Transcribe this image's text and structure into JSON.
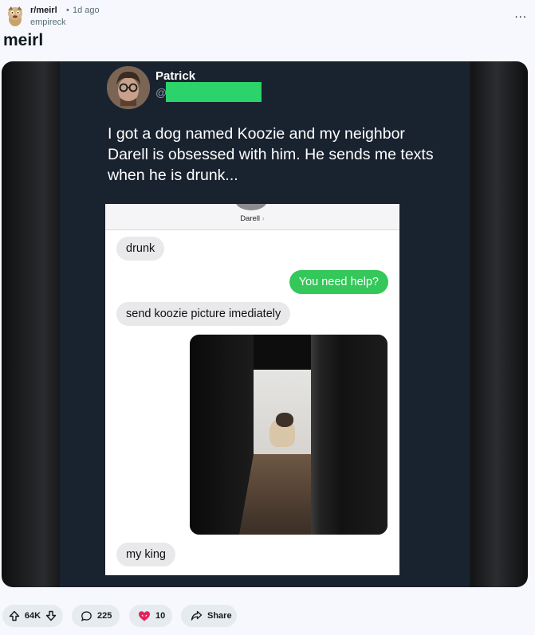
{
  "post": {
    "subreddit": "r/meirl",
    "separator": "•",
    "time_ago": "1d ago",
    "author": "empireck",
    "more_label": "...",
    "title": "meirl"
  },
  "tweet": {
    "name": "Patrick",
    "handle_prefix": "@",
    "text": "I got a dog named Koozie and my neighbor Darell is obsessed with him. He sends me texts when he is drunk..."
  },
  "screenshot": {
    "contact_name": "Darell",
    "contact_chevron": "›",
    "messages": [
      {
        "from": "them",
        "text": "drunk"
      },
      {
        "from": "me",
        "text": "You need help?"
      },
      {
        "from": "them",
        "text": "send koozie picture imediately"
      },
      {
        "from": "them",
        "text": "my king"
      }
    ]
  },
  "actions": {
    "votes": "64K",
    "comments": "225",
    "awards": "10",
    "share_label": "Share"
  },
  "icons": {
    "subreddit": "snoo-avatar-icon",
    "upvote": "arrow-up-icon",
    "downvote": "arrow-down-icon",
    "comment": "speech-bubble-icon",
    "award": "heart-award-icon",
    "share": "share-arrow-icon"
  },
  "colors": {
    "page_bg": "#f6f8fd",
    "tweet_bg": "#19222f",
    "sent_bubble": "#34c759",
    "received_bubble": "#e9e9eb",
    "action_pill": "#e5ebee"
  }
}
